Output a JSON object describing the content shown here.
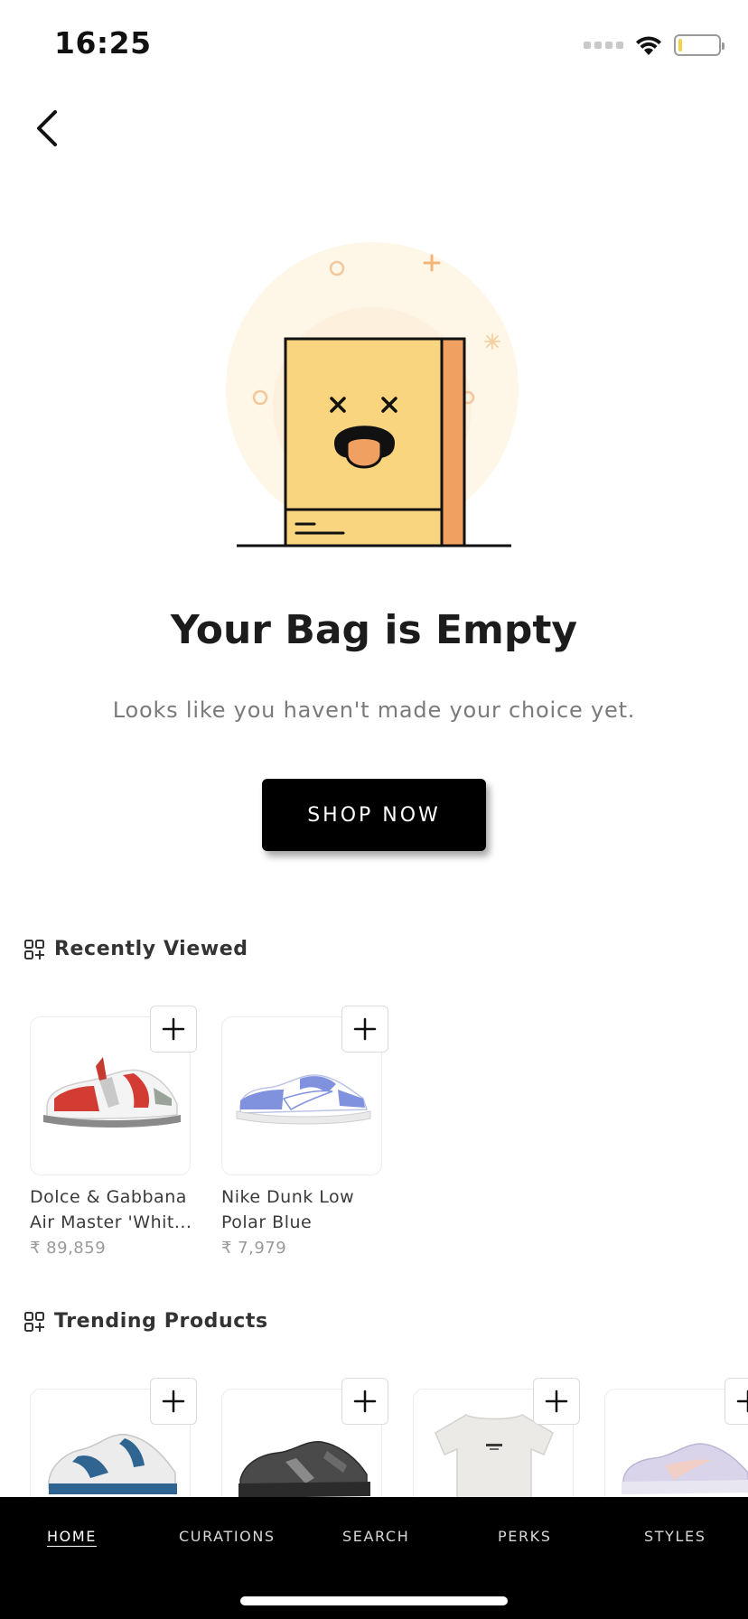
{
  "status_bar": {
    "time": "16:25"
  },
  "empty_state": {
    "title": "Your Bag is Empty",
    "subtitle": "Looks like you haven't made your choice yet.",
    "cta_label": "SHOP NOW"
  },
  "recently_viewed": {
    "title": "Recently Viewed",
    "items": [
      {
        "name_line1": "Dolce & Gabbana",
        "name_line2": "Air Master 'Whit...",
        "price": "₹ 89,859"
      },
      {
        "name_line1": "Nike Dunk Low",
        "name_line2": "Polar Blue",
        "price": "₹ 7,979"
      }
    ]
  },
  "trending_products": {
    "title": "Trending Products",
    "items": [
      {
        "image": "sneaker-white-blue"
      },
      {
        "image": "sneaker-black-grey"
      },
      {
        "image": "tshirt-cream"
      },
      {
        "image": "sneaker-lavender"
      }
    ]
  },
  "bottom_nav": {
    "items": [
      {
        "label": "HOME",
        "active": true
      },
      {
        "label": "CURATIONS",
        "active": false
      },
      {
        "label": "SEARCH",
        "active": false
      },
      {
        "label": "PERKS",
        "active": false
      },
      {
        "label": "STYLES",
        "active": false
      }
    ]
  },
  "colors": {
    "bag_yellow": "#F8D57E",
    "bag_orange": "#F0A060",
    "nav_background": "#000000",
    "accent_red": "#D0443A",
    "accent_blue": "#7C91E0"
  }
}
